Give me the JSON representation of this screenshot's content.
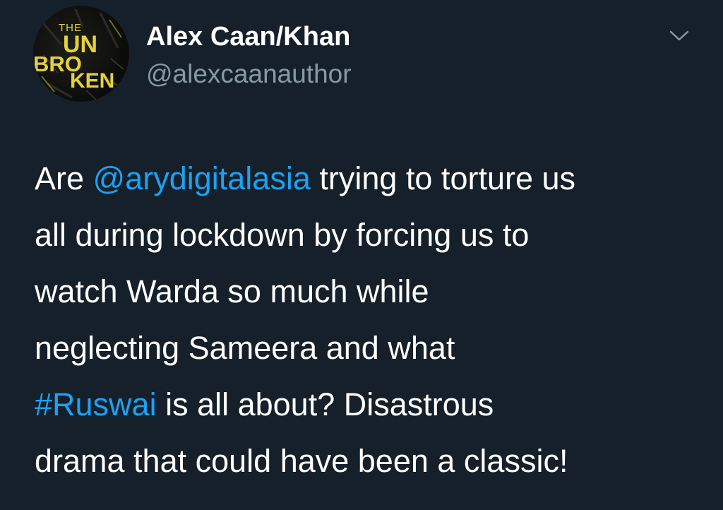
{
  "tweet": {
    "avatar": {
      "text_the": "THE",
      "text_un": "UN",
      "text_bro": "BRO",
      "text_ken": "KEN",
      "text_color": "#e3d23a"
    },
    "author": {
      "display_name": "Alex Caan/Khan",
      "handle": "@alexcaanauthor"
    },
    "more_icon": "chevron-down-icon",
    "body": {
      "l1_a": "Are ",
      "l1_mention": "@arydigitalasia",
      "l1_b": " trying to torture us",
      "l2": "all during lockdown by forcing us to",
      "l3": "watch Warda so much while",
      "l4": "neglecting Sameera and what",
      "l5_hashtag": "#Ruswai",
      "l5_b": " is all about? Disastrous",
      "l6": "drama that could have been a classic!"
    }
  },
  "colors": {
    "background": "#15202b",
    "text": "#ffffff",
    "secondary_text": "#8899a6",
    "link": "#1da1f2"
  }
}
